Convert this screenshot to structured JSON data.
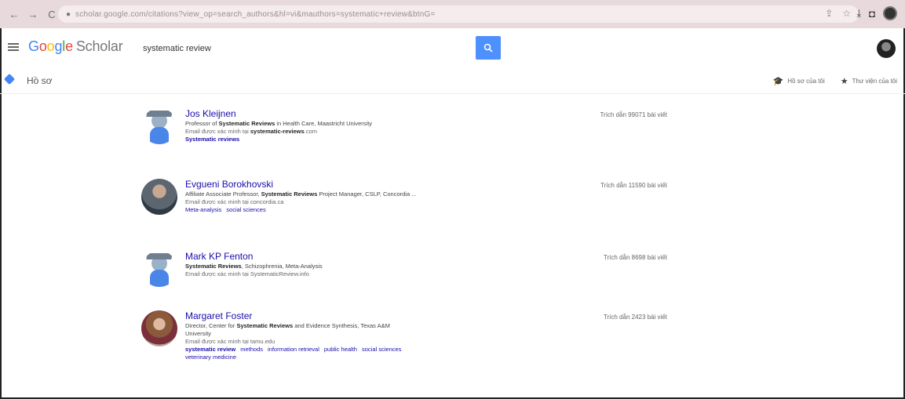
{
  "browser": {
    "url": "scholar.google.com/citations?view_op=search_authors&hl=vi&mauthors=systematic+review&btnG=",
    "back": "←",
    "forward": "→",
    "reload": "C"
  },
  "header": {
    "logo_letters": [
      "G",
      "o",
      "o",
      "g",
      "l",
      "e"
    ],
    "logo_suffix": "Scholar",
    "search_value": "systematic review"
  },
  "subnav": {
    "title": "Hồ sơ",
    "my_profile": "Hồ sơ của tôi",
    "my_library": "Thư viện của tôi"
  },
  "results": [
    {
      "name": "Jos Kleijnen",
      "affiliation": [
        "Professor of ",
        "Systematic Reviews",
        " in Health Care, Maastricht University"
      ],
      "email": [
        "Email được xác minh tại ",
        "systematic-reviews",
        ".com"
      ],
      "interests": [
        [
          "Systematic reviews",
          true
        ]
      ],
      "cited": "Trích dẫn 99071 bài viết"
    },
    {
      "name": "Evgueni Borokhovski",
      "affiliation": [
        "Affiliate Associate Professor, ",
        "Systematic Reviews",
        " Project Manager, CSLP, Concordia ..."
      ],
      "email": [
        "Email được xác minh tại concordia.ca",
        "",
        ""
      ],
      "interests": [
        [
          "Meta-analysis",
          false
        ],
        [
          "social sciences",
          false
        ]
      ],
      "cited": "Trích dẫn 11590 bài viết"
    },
    {
      "name": "Mark KP Fenton",
      "affiliation": [
        "",
        "Systematic Reviews",
        ", Schizophrenia, Meta-Analysis"
      ],
      "email": [
        "Email được xác minh tại SystematicReview.info",
        "",
        ""
      ],
      "interests": [],
      "cited": "Trích dẫn 8698 bài viết"
    },
    {
      "name": "Margaret Foster",
      "affiliation": [
        "Director, Center for ",
        "Systematic Reviews",
        " and Evidence Synthesis, Texas A&M"
      ],
      "affiliation2": "University",
      "email": [
        "Email được xác minh tại tamu.edu",
        "",
        ""
      ],
      "interests": [
        [
          "systematic review",
          true
        ],
        [
          "methods",
          false
        ],
        [
          "information retrieval",
          false
        ],
        [
          "public health",
          false
        ],
        [
          "social sciences",
          false
        ]
      ],
      "interests2": "veterinary medicine",
      "cited": "Trích dẫn 2423 bài viết"
    }
  ]
}
